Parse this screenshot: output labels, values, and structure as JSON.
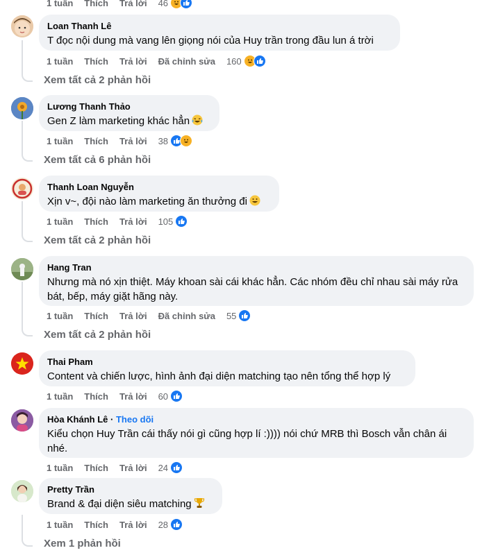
{
  "colors": {
    "like": "#1877f2",
    "haha": "#f7b125",
    "meta": "#65676b",
    "bubble": "#f0f2f5",
    "follow": "#1877f2"
  },
  "labels": {
    "time": "1 tuần",
    "like": "Thích",
    "reply": "Trả lời",
    "edited": "Đã chỉnh sửa"
  },
  "comments": [
    {
      "count": "46",
      "reactions": [
        "haha-icon",
        "like-icon"
      ]
    },
    {
      "author": "Loan Thanh Lê",
      "text": "T đọc nội dung mà vang lên giọng nói của Huy trần trong đầu lun á trời",
      "edited": true,
      "count": "160",
      "reactions": [
        "haha-icon",
        "like-icon"
      ],
      "replies": "Xem tất cả 2 phản hồi"
    },
    {
      "author": "Lương Thanh Thảo",
      "text": "Gen Z làm marketing khác hẳn",
      "emoji": "laughing-tears-emoji",
      "count": "38",
      "reactions": [
        "like-icon",
        "haha-icon"
      ],
      "replies": "Xem tất cả 6 phản hồi"
    },
    {
      "author": "Thanh Loan Nguyễn",
      "text": "Xịn v~, đội nào làm marketing ăn thưởng đi",
      "emoji": "grinning-emoji",
      "count": "105",
      "reactions": [
        "like-icon"
      ],
      "replies": "Xem tất cả 2 phản hồi"
    },
    {
      "author": "Hang Tran",
      "text": "Nhưng mà nó xịn thiệt. Máy khoan sài cái khác hẳn. Các nhóm đều chỉ nhau sài máy rửa bát, bếp, máy giặt hãng này.",
      "edited": true,
      "count": "55",
      "reactions": [
        "like-icon"
      ],
      "replies": "Xem tất cả 2 phản hồi"
    },
    {
      "author": "Thai Pham",
      "text": "Content và chiến lược, hình ảnh đại diện matching tạo nên tổng thể hợp lý",
      "count": "60",
      "reactions": [
        "like-icon"
      ]
    },
    {
      "author": "Hòa Khánh Lê",
      "follow": "Theo dõi",
      "text": "Kiểu chọn Huy Trần cái thấy nói gì cũng hợp lí :)))) nói chứ MRB thì Bosch vẫn chân ái nhé.",
      "count": "24",
      "reactions": [
        "like-icon"
      ]
    },
    {
      "author": "Pretty Trần",
      "text": "Brand & đại diện siêu matching",
      "emoji": "trophy-emoji",
      "count": "28",
      "reactions": [
        "like-icon"
      ],
      "replies": "Xem 1 phản hồi"
    }
  ]
}
